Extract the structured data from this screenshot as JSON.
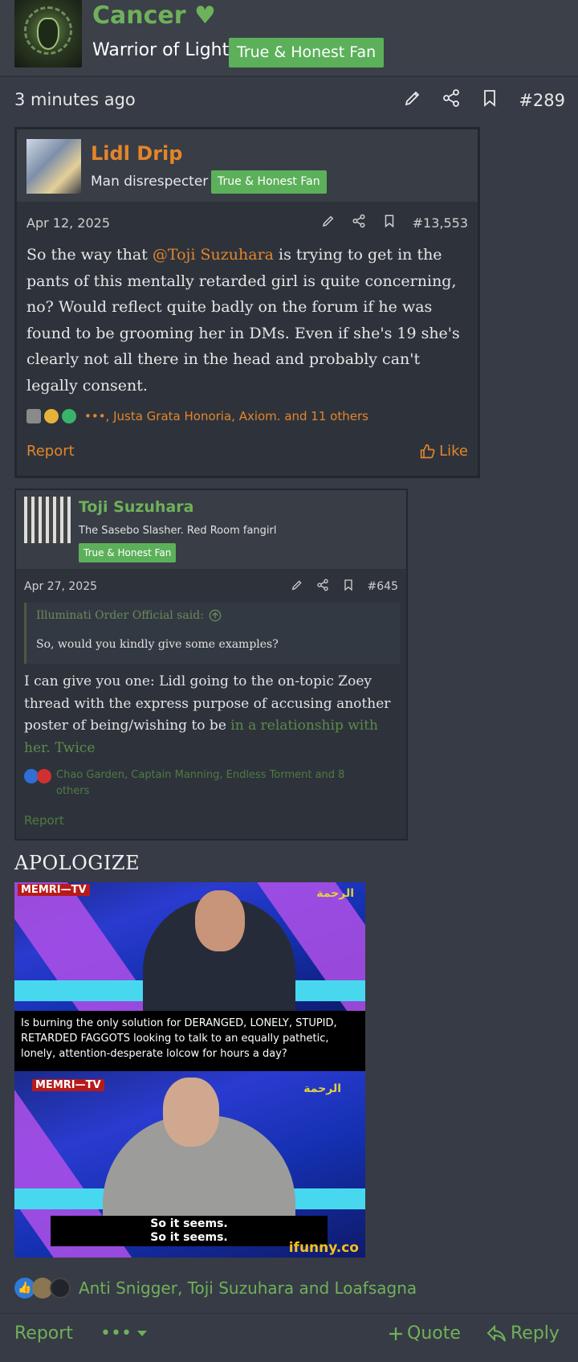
{
  "author": {
    "name": "Cancer ♥",
    "title": "Warrior of Light",
    "badge": "True & Honest Fan"
  },
  "post": {
    "time": "3 minutes ago",
    "number": "#289"
  },
  "quote1": {
    "name": "Lidl Drip",
    "title": "Man disrespecter",
    "badge": "True & Honest Fan",
    "date": "Apr 12, 2025",
    "number": "#13,553",
    "body_pre": "So the way that ",
    "mention": "@Toji Suzuhara",
    "body_post": " is trying to get in the pants of this mentally retarded girl is quite concerning, no? Would reflect quite badly on the forum if he was found to be grooming her in DMs. Even if she's 19 she's clearly not all there in the head and probably can't legally consent.",
    "reactions": "•••, Justa Grata Honoria, Axiom. and 11 others",
    "report": "Report",
    "like": "Like"
  },
  "quote2": {
    "name": "Toji Suzuhara",
    "title": "The Sasebo Slasher. Red Room fangirl",
    "badge": "True & Honest Fan",
    "date": "Apr 27, 2025",
    "number": "#645",
    "quote_head": "Illuminati Order Official said:",
    "quote_text": "So, would you kindly give some examples?",
    "body_pre": "I can give you one: Lidl going to the on-topic Zoey thread with the express purpose of accusing another poster of being/wishing to be ",
    "body_link": "in a relationship with her. Twice",
    "reactions": "Chao Garden, Captain Manning, Endless Torment and 8 others",
    "report": "Report"
  },
  "caption": "APOLOGIZE",
  "meme": {
    "logo": "MEMRI—TV",
    "logo_right": "الرحمة",
    "subtitle_top": "Is burning the only solution for DERANGED, LONELY, STUPID, RETARDED FAGGOTS looking to talk to an equally pathetic, lonely, attention-desperate lolcow for hours a day?",
    "subtitle_bottom_1": "So it seems.",
    "subtitle_bottom_2": "So it seems.",
    "watermark": "ifunny.co"
  },
  "reactions": {
    "names": "Anti Snigger, Toji Suzuhara and Loafsagna"
  },
  "footer": {
    "report": "Report",
    "more": "•••",
    "quote": "Quote",
    "reply": "Reply"
  },
  "colors": {
    "background": "#373b45",
    "accent_green": "#6fb15a",
    "accent_orange": "#e3852b",
    "badge_green": "#5cb05a"
  }
}
